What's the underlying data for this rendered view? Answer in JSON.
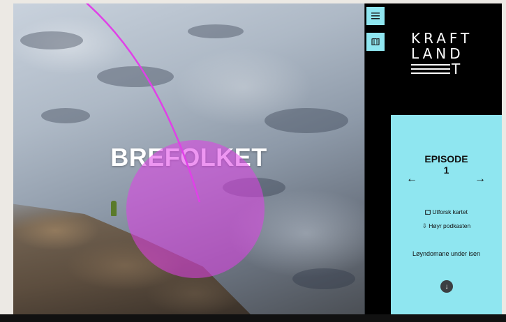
{
  "hero": {
    "title": "BREFOLKET"
  },
  "rail": {
    "menu_icon": "hamburger-menu-icon",
    "map_icon": "map-icon"
  },
  "logo": {
    "line1": "KRAFT",
    "line2": "LAND",
    "line3": "T"
  },
  "episode": {
    "label": "EPISODE",
    "number": "1",
    "prev_arrow": "←",
    "next_arrow": "→",
    "explore_map_icon": "map-icon",
    "explore_map": "Utforsk kartet",
    "podcast_icon": "download-arrow-icon",
    "podcast": "Høyr podkasten",
    "name": "Løyndomane under isen",
    "scroll_down": "↓"
  },
  "colors": {
    "accent": "#8fe6f0",
    "annotation": "#e040e8",
    "logo_bg": "#000000"
  }
}
